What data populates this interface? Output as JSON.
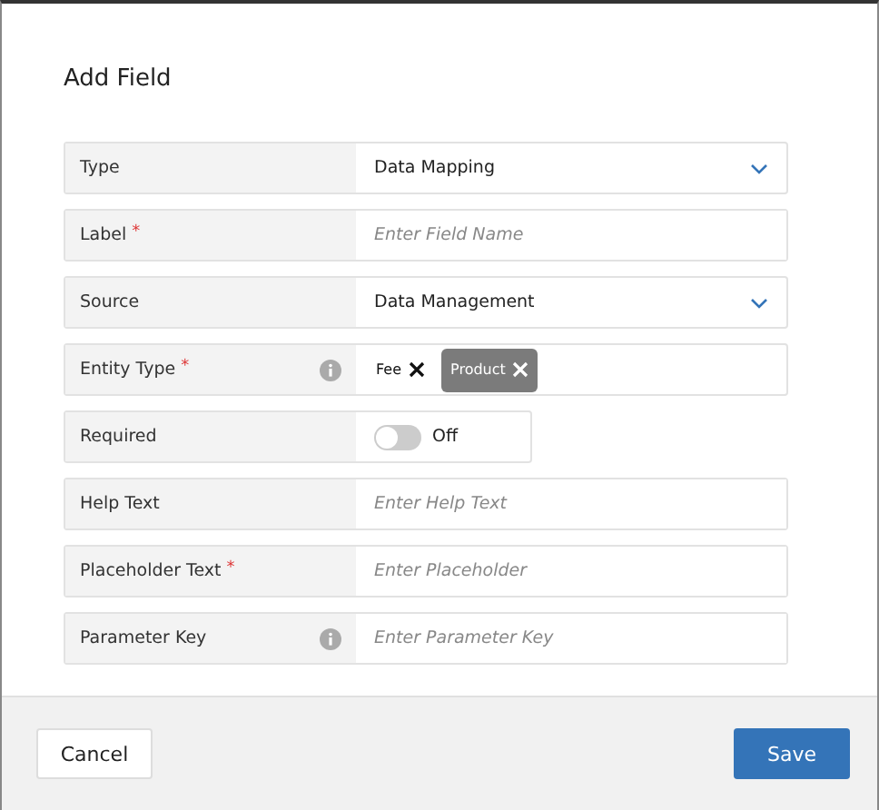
{
  "dialog": {
    "title": "Add Field"
  },
  "fields": [
    {
      "kind": "select",
      "label": "Type",
      "info": false,
      "value": "Data Mapping"
    },
    {
      "kind": "text",
      "label": "Label",
      "required_mark": "*",
      "info": false,
      "placeholder": "Enter Field Name"
    },
    {
      "kind": "select",
      "label": "Source",
      "info": false,
      "value": "Data Management"
    },
    {
      "kind": "tags",
      "label": "Entity Type",
      "required_mark": "*",
      "info": true,
      "tags": [
        {
          "label": "Fee",
          "selected": false
        },
        {
          "label": "Product",
          "selected": true
        }
      ]
    },
    {
      "kind": "toggle",
      "label": "Required",
      "info": false,
      "on": false,
      "state_label": "Off"
    },
    {
      "kind": "text",
      "label": "Help Text",
      "info": false,
      "placeholder": "Enter Help Text"
    },
    {
      "kind": "text",
      "label": "Placeholder Text",
      "required_mark": "*",
      "info": false,
      "placeholder": "Enter Placeholder"
    },
    {
      "kind": "text",
      "label": "Parameter Key",
      "info": true,
      "placeholder": "Enter Parameter Key"
    }
  ],
  "footer": {
    "buttons": [
      {
        "label": "Cancel",
        "kind": "secondary"
      },
      {
        "label": "Save",
        "kind": "primary"
      }
    ]
  }
}
